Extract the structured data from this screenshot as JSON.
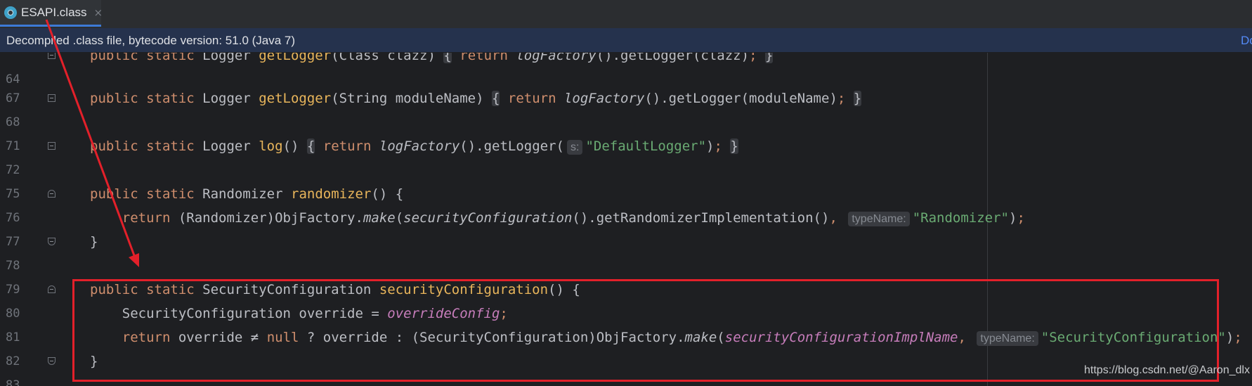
{
  "tab": {
    "title": "ESAPI.class",
    "close": "×",
    "icon": "java-class-file-icon"
  },
  "banner": {
    "text": "Decompiled .class file, bytecode version: 51.0 (Java 7)",
    "action": "Do"
  },
  "editor": {
    "lines": [
      {
        "number": "64"
      },
      {
        "number": "67"
      },
      {
        "number": "68"
      },
      {
        "number": "71"
      },
      {
        "number": "72"
      },
      {
        "number": "75"
      },
      {
        "number": "76"
      },
      {
        "number": "77"
      },
      {
        "number": "78"
      },
      {
        "number": "79"
      },
      {
        "number": "80"
      },
      {
        "number": "81"
      },
      {
        "number": "82"
      },
      {
        "number": "83"
      }
    ],
    "hints": {
      "s": "s:",
      "typeName": "typeName:"
    }
  },
  "watermark": "https://blog.csdn.net/@Aaron_dlx",
  "colors": {
    "keyword": "#cf8e6d",
    "method_decl": "#e8b55b",
    "string": "#6aab73",
    "field": "#c77dbb",
    "annotation_red": "#e3202a"
  }
}
